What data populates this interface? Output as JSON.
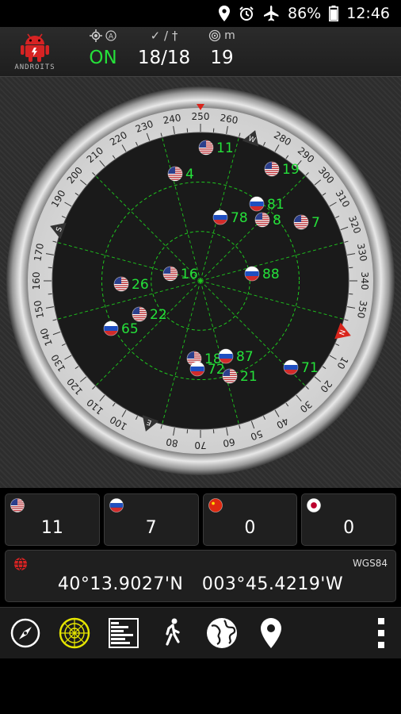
{
  "status_bar": {
    "battery": "86%",
    "time": "12:46"
  },
  "header": {
    "logo_text": "ANDROITS",
    "fix_label_icon": "gps-fix-icon",
    "fix_status": "ON",
    "satellites_label": "✓ / †",
    "satellites": "18/18",
    "accuracy_unit": "m",
    "accuracy": "19"
  },
  "radar": {
    "compass_labels": [
      "240",
      "250",
      "260",
      "280",
      "290",
      "300",
      "310",
      "320",
      "330",
      "340",
      "350",
      "10",
      "20",
      "30",
      "40",
      "50",
      "60",
      "70",
      "80",
      "100",
      "110",
      "120",
      "130",
      "140",
      "150",
      "160",
      "170",
      "190",
      "200",
      "210",
      "220",
      "230"
    ],
    "cardinals": {
      "north": "N",
      "east": "E",
      "south": "S",
      "west": "W"
    },
    "satellites": [
      {
        "id": "11",
        "flag": "us"
      },
      {
        "id": "4",
        "flag": "us"
      },
      {
        "id": "19",
        "flag": "us"
      },
      {
        "id": "81",
        "flag": "ru"
      },
      {
        "id": "78",
        "flag": "ru"
      },
      {
        "id": "8",
        "flag": "us"
      },
      {
        "id": "7",
        "flag": "us"
      },
      {
        "id": "26",
        "flag": "us"
      },
      {
        "id": "16",
        "flag": "us"
      },
      {
        "id": "88",
        "flag": "ru"
      },
      {
        "id": "22",
        "flag": "us"
      },
      {
        "id": "65",
        "flag": "ru"
      },
      {
        "id": "18",
        "flag": "us"
      },
      {
        "id": "87",
        "flag": "ru"
      },
      {
        "id": "72",
        "flag": "ru"
      },
      {
        "id": "21",
        "flag": "us"
      },
      {
        "id": "71",
        "flag": "ru"
      }
    ]
  },
  "counts": [
    {
      "constellation": "GPS",
      "flag": "us",
      "value": "11"
    },
    {
      "constellation": "GLONASS",
      "flag": "ru",
      "value": "7"
    },
    {
      "constellation": "BeiDou",
      "flag": "cn",
      "value": "0"
    },
    {
      "constellation": "QZSS",
      "flag": "jp",
      "value": "0"
    }
  ],
  "position": {
    "datum": "WGS84",
    "latitude": "40°13.9027'N",
    "longitude": "003°45.4219'W"
  },
  "nav": [
    "compass-icon",
    "radar-icon",
    "signal-bars-icon",
    "walking-person-icon",
    "globe-icon",
    "location-pin-icon",
    "more-vert-icon"
  ],
  "colors": {
    "accent_green": "#25e03a",
    "grid_green": "#1ec81e",
    "north_red": "#d9251c"
  }
}
